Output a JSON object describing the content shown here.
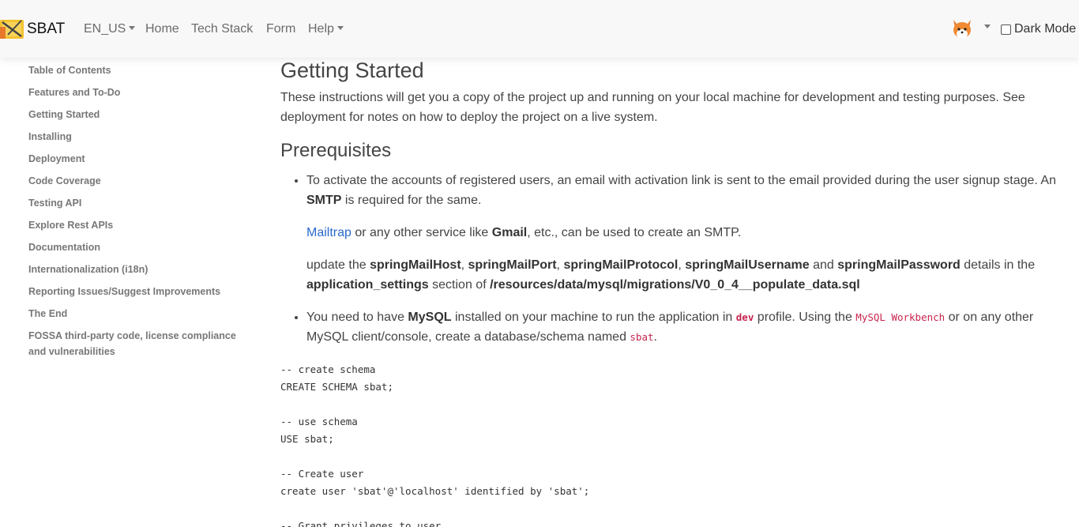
{
  "nav": {
    "brand": "SBAT",
    "language": "EN_US",
    "home": "Home",
    "tech_stack": "Tech Stack",
    "form": "Form",
    "help": "Help",
    "dark_mode": "Dark Mode"
  },
  "sidebar": {
    "items": [
      "Table of Contents",
      "Features and To-Do",
      "Getting Started",
      "Installing",
      "Deployment",
      "Code Coverage",
      "Testing API",
      "Explore Rest APIs",
      "Documentation",
      "Internationalization (i18n)",
      "Reporting Issues/Suggest Improvements",
      "The End",
      "FOSSA third-party code, license compliance and vulnerabilities"
    ]
  },
  "main": {
    "title": "Getting Started",
    "intro": "These instructions will get you a copy of the project up and running on your local machine for development and testing purposes. See deployment for notes on how to deploy the project on a live system.",
    "prereq_title": "Prerequisites",
    "item1": {
      "text_a": "To activate the accounts of registered users, an email with activation link is sent to the email provided during the user signup stage. An ",
      "smtp": "SMTP",
      "text_b": " is required for the same.",
      "mailtrap": "Mailtrap",
      "text_c": " or any other service like ",
      "gmail": "Gmail",
      "text_d": ", etc., can be used to create an SMTP.",
      "update": "update the ",
      "host": "springMailHost",
      "comma1": ", ",
      "port": "springMailPort",
      "comma2": ", ",
      "protocol": "springMailProtocol",
      "comma3": ", ",
      "username": "springMailUsername",
      "and": " and ",
      "password": "springMailPassword",
      "details": " details in the ",
      "settings": "application_settings",
      "section": " section of ",
      "path": "/resources/data/mysql/migrations/V0_0_4__populate_data.sql"
    },
    "item2": {
      "text_a": "You need to have ",
      "mysql": "MySQL",
      "text_b": " installed on your machine to run the application in ",
      "dev": "dev",
      "text_c": " profile. Using the ",
      "workbench": "MySQL Workbench",
      "text_d": " or on any other MySQL client/console, create a database/schema named ",
      "sbat": "sbat",
      "text_e": "."
    },
    "code": [
      "-- create schema",
      "CREATE SCHEMA sbat;",
      "",
      "-- use schema",
      "USE sbat;",
      "",
      "-- Create user",
      "create user 'sbat'@'localhost' identified by 'sbat';",
      "",
      "-- Grant privileges to user"
    ]
  },
  "colors": {
    "navbar_bg": "#f8f8f8",
    "link": "#2a6acb",
    "inline_code": "#c7254e",
    "sidebar_text": "#777777"
  }
}
